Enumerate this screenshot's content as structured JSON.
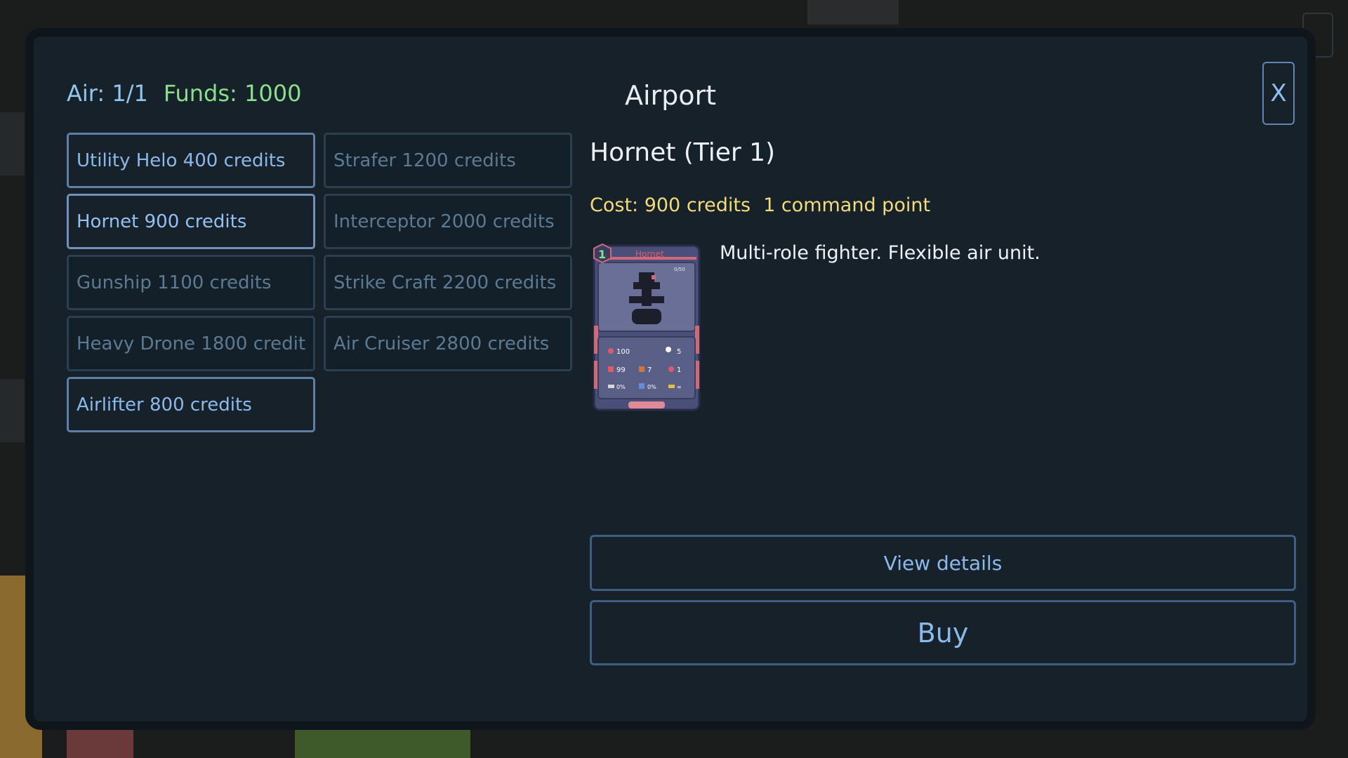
{
  "header": {
    "air_label": "Air: 1/1",
    "funds_label": "Funds: 1000",
    "title": "Airport",
    "close_label": "X"
  },
  "units": [
    {
      "label": "Utility Helo  400 credits",
      "state": "enabled"
    },
    {
      "label": "Strafer  1200 credits",
      "state": "disabled"
    },
    {
      "label": "Hornet  900 credits",
      "state": "selected"
    },
    {
      "label": "Interceptor  2000 credits",
      "state": "disabled"
    },
    {
      "label": "Gunship  1100 credits",
      "state": "disabled"
    },
    {
      "label": "Strike Craft  2200 credits",
      "state": "disabled"
    },
    {
      "label": "Heavy Drone  1800 credit",
      "state": "disabled"
    },
    {
      "label": "Air Cruiser  2800 credits",
      "state": "disabled"
    },
    {
      "label": "Airlifter  800 credits",
      "state": "enabled"
    }
  ],
  "detail": {
    "name": "Hornet (Tier 1)",
    "cost": "Cost: 900 credits",
    "command_points": "1 command point",
    "description": "Multi-role fighter. Flexible air unit.",
    "card": {
      "tier": "1",
      "name": "Hornet",
      "counter": "0/50",
      "stats": [
        "100",
        "5",
        "99",
        "7",
        "1",
        "0%",
        "0%",
        "∞"
      ]
    }
  },
  "actions": {
    "view_details": "View details",
    "buy": "Buy"
  },
  "colors": {
    "panel_bg": "#17212a",
    "air_text": "#8fc7f0",
    "funds_text": "#8ae08a",
    "cost_text": "#f2dc7a",
    "button_text": "#8cb9ec"
  }
}
